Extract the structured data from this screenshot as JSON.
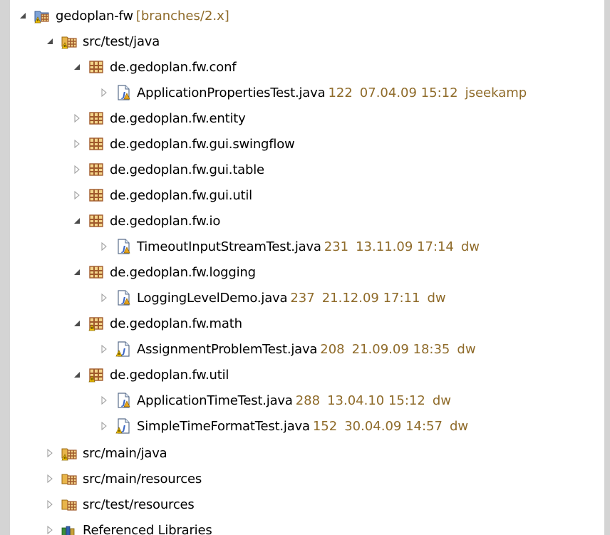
{
  "colors": {
    "decoration": "#8f6b2a",
    "package_brown": "#a05a2c",
    "java_blue": "#3b66c5",
    "folder_yellow": "#d8a23a"
  },
  "tree": {
    "project": {
      "name": "gedoplan-fw",
      "decoration": "[branches/2.x]"
    },
    "src_test_java": {
      "name": "src/test/java"
    },
    "pkg_conf": {
      "name": "de.gedoplan.fw.conf"
    },
    "file_app_props": {
      "name": "ApplicationPropertiesTest.java",
      "rev": "122",
      "date": "07.04.09 15:12",
      "author": "jseekamp"
    },
    "pkg_entity": {
      "name": "de.gedoplan.fw.entity"
    },
    "pkg_swingflow": {
      "name": "de.gedoplan.fw.gui.swingflow"
    },
    "pkg_table": {
      "name": "de.gedoplan.fw.gui.table"
    },
    "pkg_guiutil": {
      "name": "de.gedoplan.fw.gui.util"
    },
    "pkg_io": {
      "name": "de.gedoplan.fw.io"
    },
    "file_timeout": {
      "name": "TimeoutInputStreamTest.java",
      "rev": "231",
      "date": "13.11.09 17:14",
      "author": "dw"
    },
    "pkg_logging": {
      "name": "de.gedoplan.fw.logging"
    },
    "file_logging": {
      "name": "LoggingLevelDemo.java",
      "rev": "237",
      "date": "21.12.09 17:11",
      "author": "dw"
    },
    "pkg_math": {
      "name": "de.gedoplan.fw.math"
    },
    "file_assign": {
      "name": "AssignmentProblemTest.java",
      "rev": "208",
      "date": "21.09.09 18:35",
      "author": "dw"
    },
    "pkg_util": {
      "name": "de.gedoplan.fw.util"
    },
    "file_apptime": {
      "name": "ApplicationTimeTest.java",
      "rev": "288",
      "date": "13.04.10 15:12",
      "author": "dw"
    },
    "file_simpletime": {
      "name": "SimpleTimeFormatTest.java",
      "rev": "152",
      "date": "30.04.09 14:57",
      "author": "dw"
    },
    "src_main_java": {
      "name": "src/main/java"
    },
    "src_main_resources": {
      "name": "src/main/resources"
    },
    "src_test_resources": {
      "name": "src/test/resources"
    },
    "ref_libs": {
      "name": "Referenced Libraries"
    }
  },
  "icons": {
    "expanded": "triangle-expanded-icon",
    "collapsed": "triangle-collapsed-icon",
    "project": "svn-project-icon",
    "source_folder": "source-folder-icon",
    "package": "package-icon",
    "java_file": "java-file-icon",
    "library": "library-icon"
  }
}
